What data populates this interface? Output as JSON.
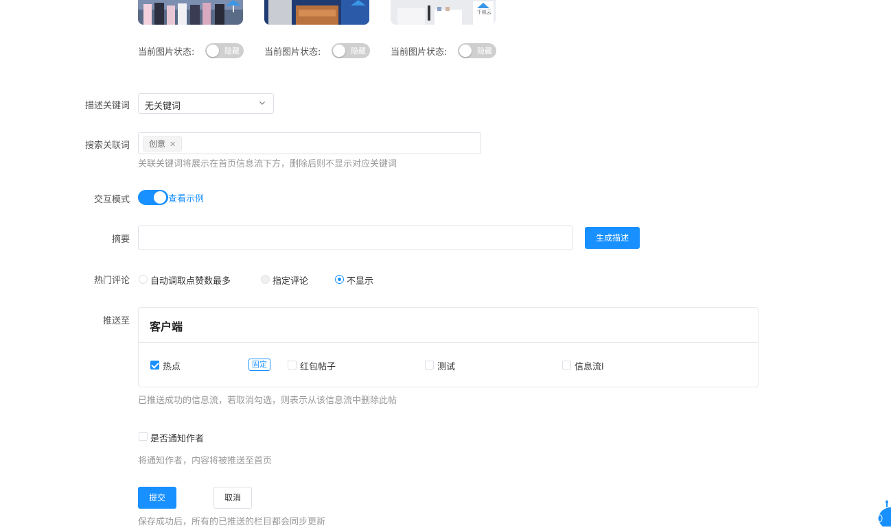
{
  "images": [
    {
      "status_label": "当前图片状态:",
      "toggle_text": "隐藏"
    },
    {
      "status_label": "当前图片状态:",
      "toggle_text": "隐藏"
    },
    {
      "status_label": "当前图片状态:",
      "toggle_text": "隐藏"
    }
  ],
  "keyword": {
    "label": "描述关键词",
    "value": "无关键词"
  },
  "related": {
    "label": "搜索关联词",
    "tag": "创意",
    "hint": "关联关键词将展示在首页信息流下方，删除后则不显示对应关键词"
  },
  "interaction": {
    "label": "交互模式",
    "link": "查看示例",
    "enabled": true
  },
  "summary": {
    "label": "摘要",
    "value": "",
    "generate_button": "生成描述"
  },
  "hot_comment": {
    "label": "热门评论",
    "options": [
      "自动调取点赞数最多",
      "指定评论",
      "不显示"
    ],
    "selected": 2
  },
  "push": {
    "label": "推送至",
    "panel_title": "客户端",
    "items": [
      {
        "label": "热点",
        "checked": true
      },
      {
        "label": "红包帖子",
        "checked": false
      },
      {
        "label": "测试",
        "checked": false
      },
      {
        "label": "信息流l",
        "checked": false
      }
    ],
    "fixed_tag": "固定",
    "hint": "已推送成功的信息流，若取消勾选，则表示从该信息流中删除此帖"
  },
  "notify": {
    "label": "是否通知作者",
    "hint": "将通知作者，内容将被推送至首页"
  },
  "actions": {
    "submit": "提交",
    "cancel": "取消",
    "hint": "保存成功后，所有的已推送的栏目都会同步更新"
  },
  "thumb_watermark": "千帆云",
  "colors": {
    "accent": "#1890ff",
    "toggle_off": "#cfcfcf",
    "hint": "#999999"
  }
}
